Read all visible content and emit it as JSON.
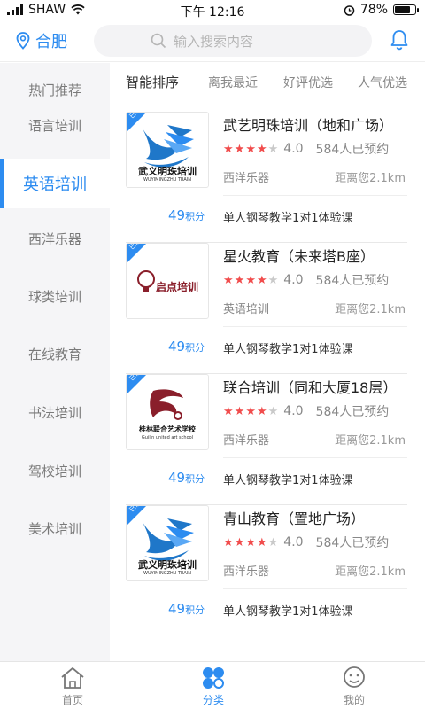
{
  "status": {
    "carrier": "SHAW",
    "time": "下午 12:16",
    "battery": "78%",
    "battery_level": 0.78
  },
  "header": {
    "city": "合肥",
    "search_placeholder": "输入搜索内容"
  },
  "sidebar": {
    "items": [
      {
        "label": "热门推荐",
        "active": false
      },
      {
        "label": "语言培训",
        "active": false
      },
      {
        "label": "英语培训",
        "active": true
      },
      {
        "label": "西洋乐器",
        "active": false
      },
      {
        "label": "球类培训",
        "active": false
      },
      {
        "label": "在线教育",
        "active": false
      },
      {
        "label": "书法培训",
        "active": false
      },
      {
        "label": "驾校培训",
        "active": false
      },
      {
        "label": "美术培训",
        "active": false
      }
    ]
  },
  "sort": {
    "options": [
      "智能排序",
      "离我最近",
      "好评优选",
      "人气优选"
    ],
    "active": "智能排序"
  },
  "cards": [
    {
      "badge": "已认证",
      "logo_text": "武义明珠培训",
      "logo_sub": "WUYIMINGZHU TRAIN",
      "title": "武艺明珠培训（地和广场）",
      "rating": 4.0,
      "score": "4.0",
      "appointments": "584人已预约",
      "category": "西洋乐器",
      "distance": "距离您2.1km",
      "points": "49",
      "points_unit": "积分",
      "course": "单人钢琴教学1对1体验课"
    },
    {
      "badge": "已认证",
      "logo_text": "启点培训",
      "logo_sub": "",
      "title": "星火教育（未来塔B座）",
      "rating": 4.0,
      "score": "4.0",
      "appointments": "584人已预约",
      "category": "英语培训",
      "distance": "距离您2.1km",
      "points": "49",
      "points_unit": "积分",
      "course": "单人钢琴教学1对1体验课"
    },
    {
      "badge": "已认证",
      "logo_text": "桂林联合艺术学校",
      "logo_sub": "Guilin united art school",
      "title": "联合培训（同和大厦18层）",
      "rating": 4.0,
      "score": "4.0",
      "appointments": "584人已预约",
      "category": "西洋乐器",
      "distance": "距离您2.1km",
      "points": "49",
      "points_unit": "积分",
      "course": "单人钢琴教学1对1体验课"
    },
    {
      "badge": "已认证",
      "logo_text": "武义明珠培训",
      "logo_sub": "WUYIMINGZHU TRAIN",
      "title": "青山教育（置地广场）",
      "rating": 4.0,
      "score": "4.0",
      "appointments": "584人已预约",
      "category": "西洋乐器",
      "distance": "距离您2.1km",
      "points": "49",
      "points_unit": "积分",
      "course": "单人钢琴教学1对1体验课"
    }
  ],
  "tabbar": {
    "items": [
      {
        "label": "首页",
        "icon": "home-icon",
        "active": false
      },
      {
        "label": "分类",
        "icon": "category-icon",
        "active": true
      },
      {
        "label": "我的",
        "icon": "profile-icon",
        "active": false
      }
    ]
  },
  "colors": {
    "accent": "#2d8cf0",
    "star": "#f14c4c",
    "sidebar_bg": "#f5f5f7"
  }
}
